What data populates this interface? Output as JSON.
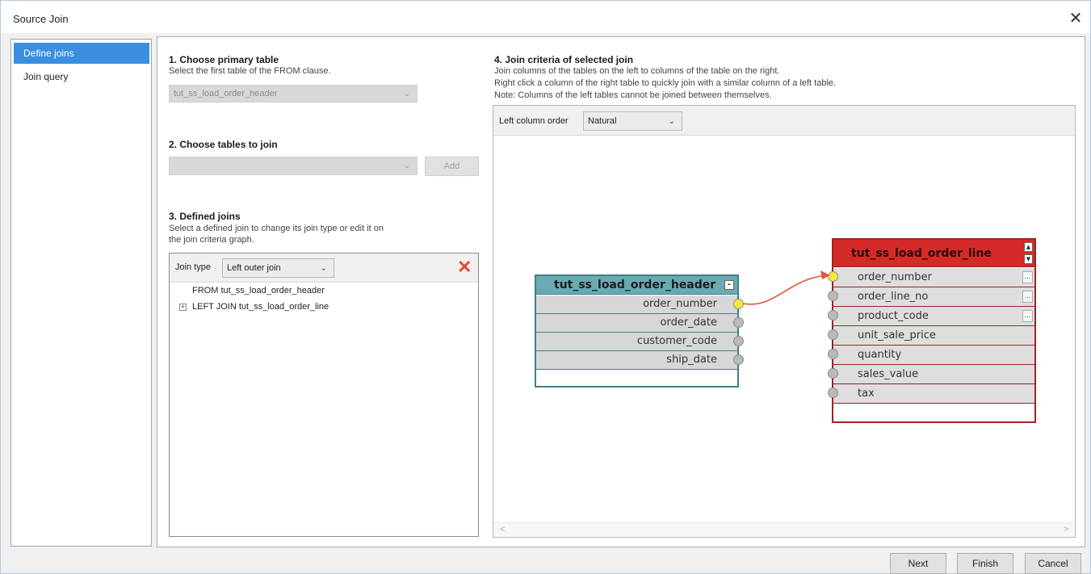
{
  "window": {
    "title": "Source Join",
    "close_glyph": "✕"
  },
  "nav": {
    "items": [
      {
        "label": "Define joins",
        "active": true
      },
      {
        "label": "Join query",
        "active": false
      }
    ]
  },
  "step1": {
    "heading": "1. Choose primary table",
    "desc": "Select the first table of the FROM clause.",
    "value": "tut_ss_load_order_header"
  },
  "step2": {
    "heading": "2. Choose tables to join",
    "value": "",
    "add_label": "Add"
  },
  "step3": {
    "heading": "3. Defined joins",
    "desc_line1": "Select a defined join to change its join type or edit it on",
    "desc_line2": "the join criteria graph.",
    "join_type_label": "Join type",
    "join_type_value": "Left outer join",
    "tree": [
      "FROM tut_ss_load_order_header",
      "LEFT JOIN tut_ss_load_order_line"
    ]
  },
  "step4": {
    "heading": "4. Join criteria of selected join",
    "desc_line1": "Join columns of the tables on the left to columns of the table on the right.",
    "desc_line2": "Right click a column of the right table to quickly join with a similar column of a left table.",
    "desc_line3": "Note: Columns of the left tables cannot be joined between themselves.",
    "left_order_label": "Left column order",
    "left_order_value": "Natural"
  },
  "left_table": {
    "name": "tut_ss_load_order_header",
    "columns": [
      "order_number",
      "order_date",
      "customer_code",
      "ship_date"
    ],
    "joined_column": "order_number"
  },
  "right_table": {
    "name": "tut_ss_load_order_line",
    "columns": [
      "order_number",
      "order_line_no",
      "product_code",
      "unit_sale_price",
      "quantity",
      "sales_value",
      "tax"
    ],
    "joined_column": "order_number"
  },
  "colors": {
    "left_header": "#6aaab3",
    "left_row": "#d7d7d7",
    "right_header": "#d42a2a",
    "right_row": "#dedede",
    "connector": "#e8533a",
    "joined_dot": "#f2ea3a",
    "unjoined_dot": "#b9b9b9"
  },
  "footer": {
    "next": "Next",
    "finish": "Finish",
    "cancel": "Cancel"
  }
}
